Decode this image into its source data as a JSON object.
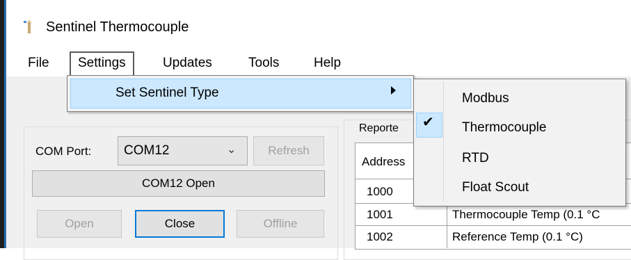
{
  "window": {
    "title": "Sentinel Thermocouple"
  },
  "menubar": {
    "items": [
      "File",
      "Settings",
      "Updates",
      "Tools",
      "Help"
    ]
  },
  "settings_menu": {
    "item": "Set Sentinel Type"
  },
  "sentinel_type_menu": {
    "items": [
      "Modbus",
      "Thermocouple",
      "RTD",
      "Float Scout"
    ],
    "checked_index": 1
  },
  "connection": {
    "com_port_label": "COM Port:",
    "com_port_value": "COM12",
    "refresh_label": "Refresh",
    "status_text": "COM12 Open",
    "open_label": "Open",
    "close_label": "Close",
    "offline_label": "Offline"
  },
  "reported": {
    "group_title": "Reporte",
    "header": "Address",
    "rows": [
      {
        "address": "1000",
        "desc": ""
      },
      {
        "address": "1001",
        "desc": "Thermocouple Temp (0.1 °C"
      },
      {
        "address": "1002",
        "desc": "Reference Temp (0.1 °C)"
      }
    ]
  }
}
